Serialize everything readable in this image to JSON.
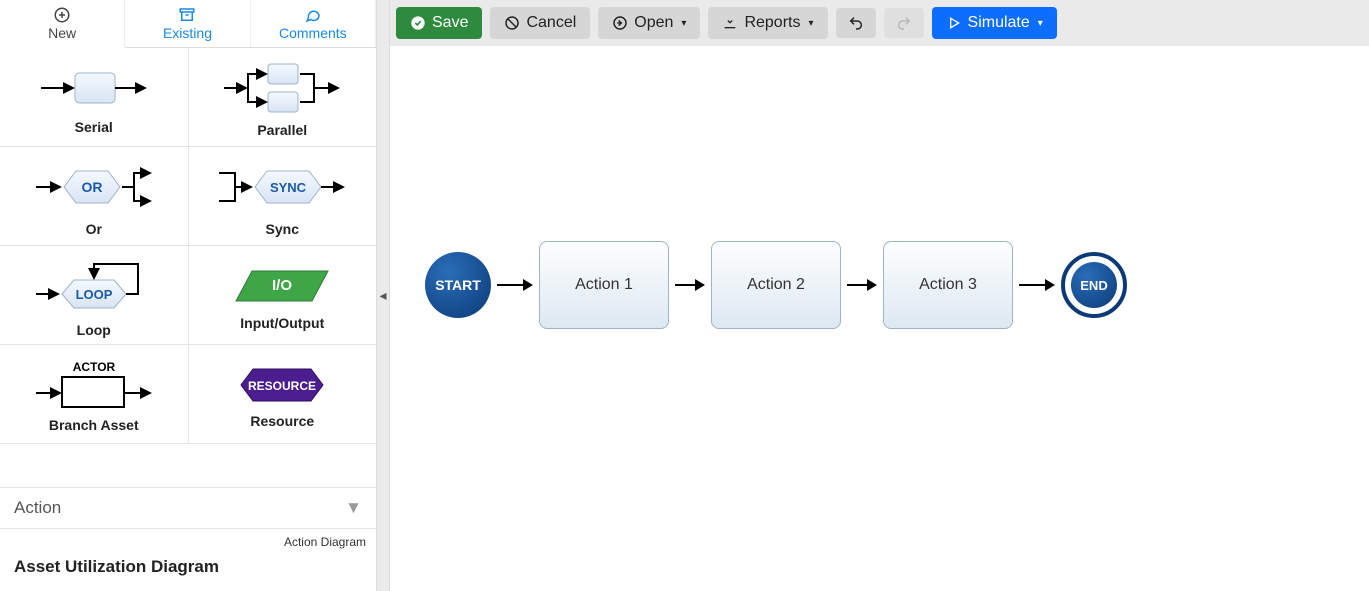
{
  "tabs": {
    "new": "New",
    "existing": "Existing",
    "comments": "Comments"
  },
  "palette": {
    "serial": "Serial",
    "parallel": "Parallel",
    "or": "Or",
    "or_badge": "OR",
    "sync": "Sync",
    "sync_badge": "SYNC",
    "loop": "Loop",
    "loop_badge": "LOOP",
    "io": "Input/Output",
    "io_badge": "I/O",
    "branch": "Branch Asset",
    "branch_badge": "ACTOR",
    "resource": "Resource",
    "resource_badge": "RESOURCE"
  },
  "dropdown": {
    "label": "Action"
  },
  "section": {
    "overline": "Action Diagram",
    "title": "Asset Utilization Diagram"
  },
  "toolbar": {
    "save": "Save",
    "cancel": "Cancel",
    "open": "Open",
    "reports": "Reports",
    "simulate": "Simulate"
  },
  "flow": {
    "start": "START",
    "actions": [
      "Action 1",
      "Action 2",
      "Action 3"
    ],
    "end": "END"
  }
}
